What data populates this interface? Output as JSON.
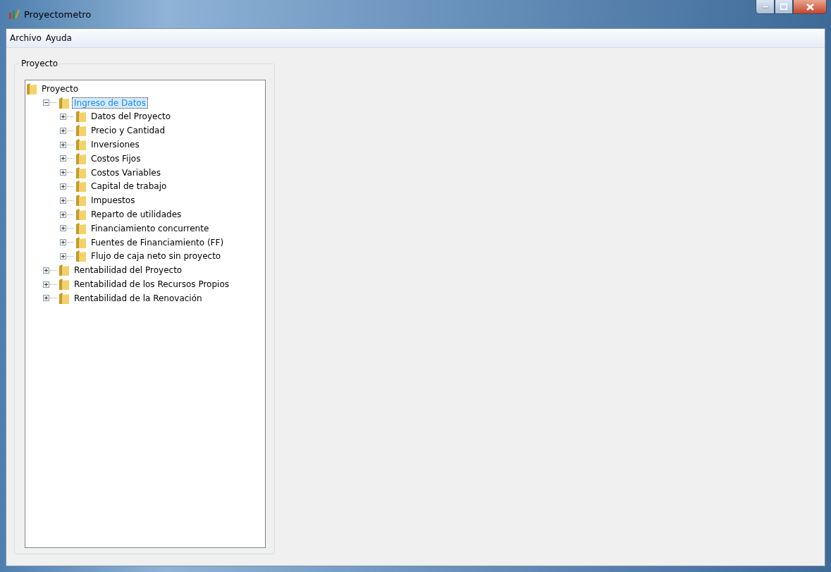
{
  "window": {
    "title": "Proyectometro"
  },
  "menu": [
    {
      "label": "Archivo"
    },
    {
      "label": "Ayuda"
    }
  ],
  "group": {
    "title": "Proyecto"
  },
  "tree": {
    "label": "Proyecto",
    "selected": false,
    "children": [
      {
        "label": "Ingreso de Datos",
        "selected": true,
        "expanded": true,
        "children": [
          {
            "label": "Datos del Proyecto",
            "selected": false,
            "expanded": false
          },
          {
            "label": "Precio y Cantidad",
            "selected": false,
            "expanded": false
          },
          {
            "label": "Inversiones",
            "selected": false,
            "expanded": false
          },
          {
            "label": "Costos Fijos",
            "selected": false,
            "expanded": false
          },
          {
            "label": "Costos Variables",
            "selected": false,
            "expanded": false
          },
          {
            "label": "Capital de trabajo",
            "selected": false,
            "expanded": false
          },
          {
            "label": "Impuestos",
            "selected": false,
            "expanded": false
          },
          {
            "label": "Reparto de utilidades",
            "selected": false,
            "expanded": false
          },
          {
            "label": "Financiamiento concurrente",
            "selected": false,
            "expanded": false
          },
          {
            "label": "Fuentes de Financiamiento (FF)",
            "selected": false,
            "expanded": false
          },
          {
            "label": "Flujo de caja neto sin proyecto",
            "selected": false,
            "expanded": false
          }
        ]
      },
      {
        "label": "Rentabilidad del Proyecto",
        "selected": false,
        "expanded": false
      },
      {
        "label": "Rentabilidad de los Recursos Propios",
        "selected": false,
        "expanded": false
      },
      {
        "label": "Rentabilidad de la Renovación",
        "selected": false,
        "expanded": false
      }
    ]
  }
}
